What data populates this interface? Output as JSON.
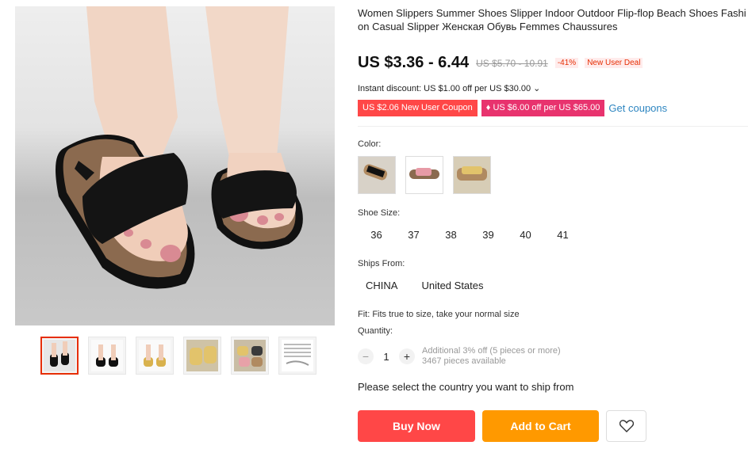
{
  "product": {
    "title_line1": "Women Slippers Summer Shoes Slipper Indoor Outdoor Flip-flop Beach Shoes Fashi",
    "title_line2": "on Casual Slipper Женская Обувь Femmes Chaussures"
  },
  "price": {
    "current": "US $3.36 - 6.44",
    "original": "US $5.70 - 10.91",
    "discount": "-41%",
    "deal": "New User Deal"
  },
  "discounts": {
    "instant": "Instant discount: US $1.00 off per US $30.00 ⌄",
    "coupon1": "US $2.06 New User Coupon",
    "coupon2": "♦ US $6.00 off per US $65.00",
    "get_coupons": "Get coupons"
  },
  "options": {
    "color_label": "Color:",
    "colors": [
      "black-brown",
      "pink",
      "yellow"
    ],
    "size_label": "Shoe Size:",
    "sizes": [
      "36",
      "37",
      "38",
      "39",
      "40",
      "41"
    ],
    "ships_label": "Ships From:",
    "ships": [
      "CHINA",
      "United States"
    ],
    "fit": "Fit: Fits true to size, take your normal size"
  },
  "quantity": {
    "label": "Quantity:",
    "value": "1",
    "minus": "−",
    "plus": "+",
    "note1": "Additional 3% off (5 pieces or more)",
    "note2": "3467 pieces available"
  },
  "ship_message": "Please select the country you want to ship from",
  "buttons": {
    "buy": "Buy Now",
    "cart": "Add to Cart"
  },
  "icons": {
    "wishlist": "heart-icon"
  },
  "colors": {
    "accent_red": "#ff4747",
    "accent_orange": "#ff9900",
    "coupon_pink": "#e8336e",
    "link_blue": "#2e86c1"
  }
}
